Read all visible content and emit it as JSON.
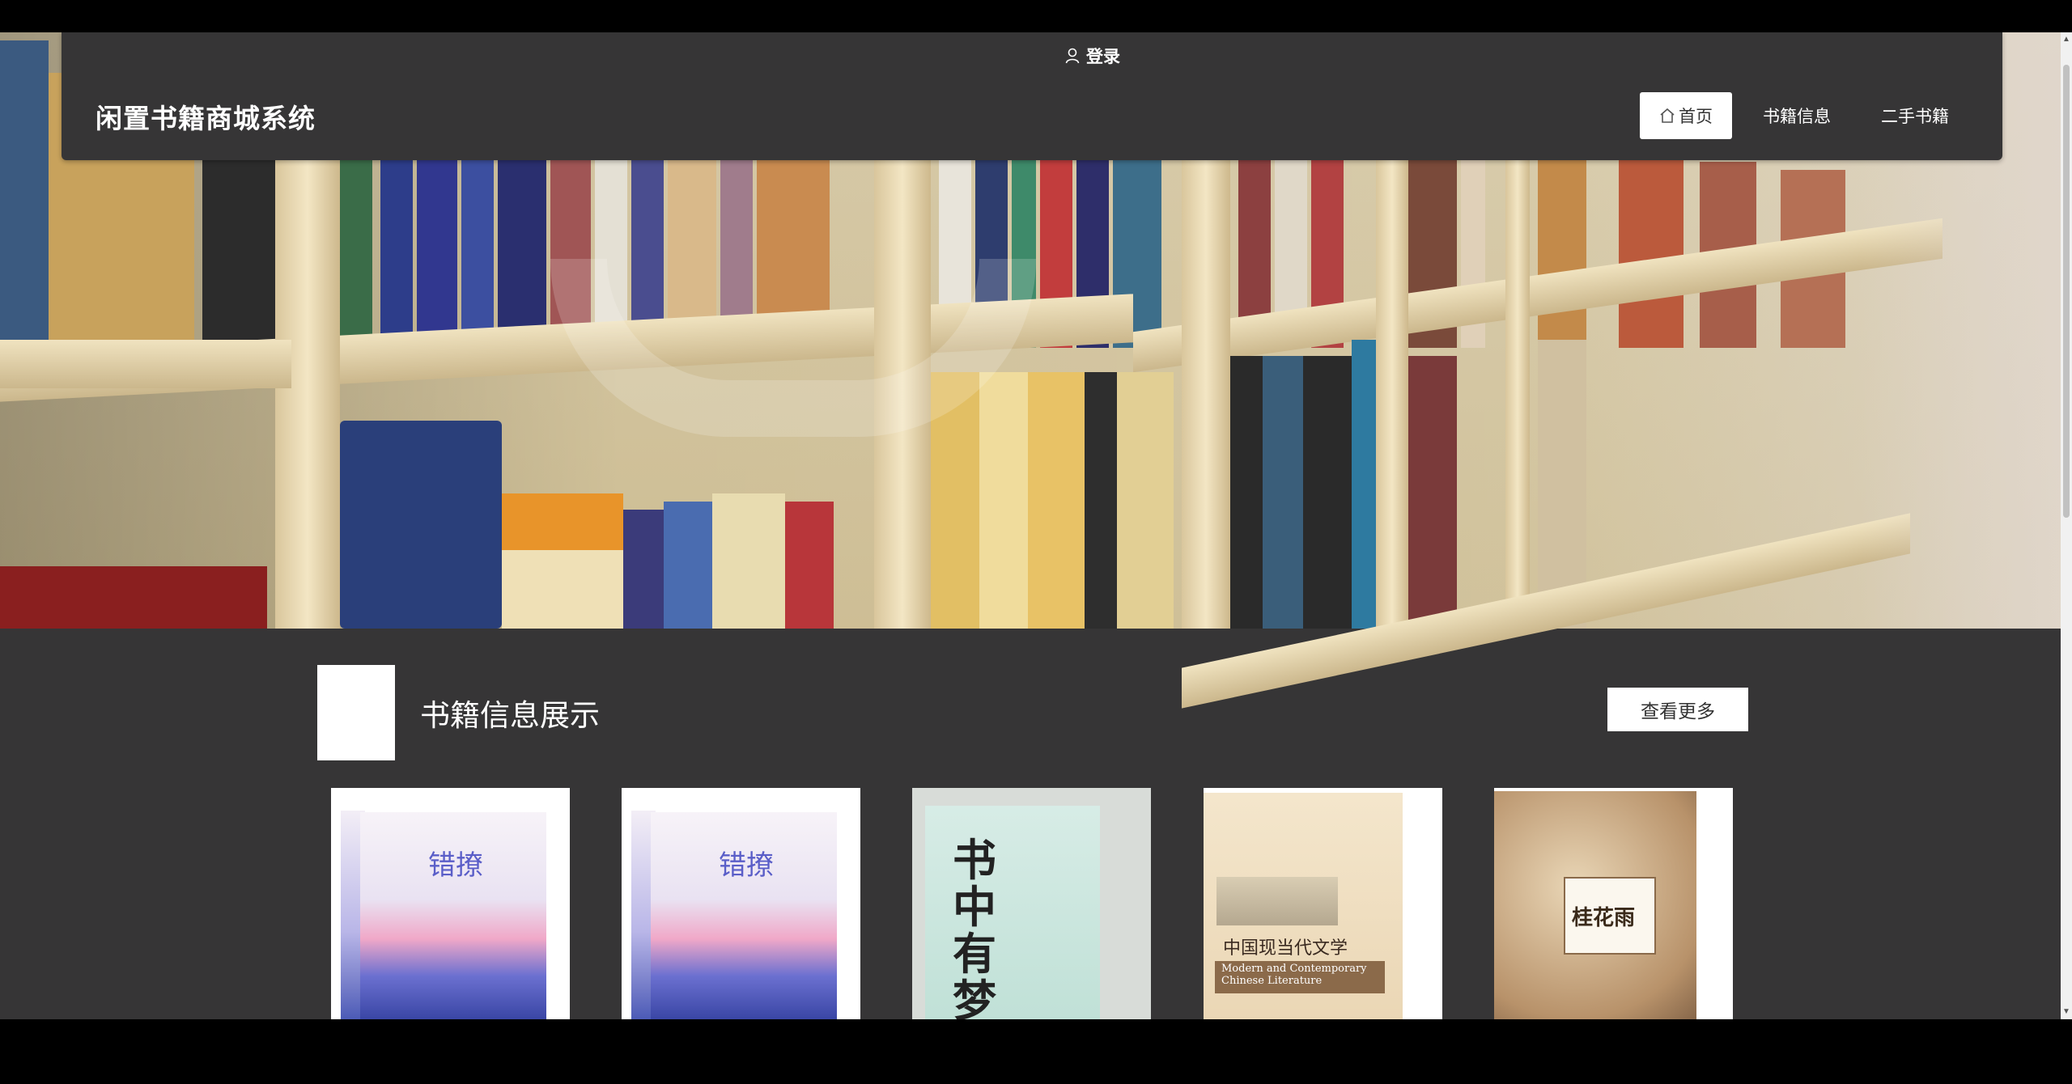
{
  "header": {
    "login_label": "登录",
    "brand": "闲置书籍商城系统",
    "menu": [
      {
        "label": "首页",
        "active": true,
        "icon": "home-icon"
      },
      {
        "label": "书籍信息",
        "active": false
      },
      {
        "label": "二手书籍",
        "active": false
      }
    ]
  },
  "section": {
    "title": "书籍信息展示",
    "more_label": "查看更多"
  },
  "books": [
    {
      "cover_title": "错撩"
    },
    {
      "cover_title": "错撩"
    },
    {
      "cover_title": "书中有梦"
    },
    {
      "cover_title": "中国现当代文学",
      "cover_subtitle": "Modern and Contemporary Chinese Literature"
    },
    {
      "cover_title": "桂花雨"
    }
  ],
  "colors": {
    "page_background": "#363536",
    "nav_background": "#363536",
    "active_menu": "#ffffff"
  }
}
